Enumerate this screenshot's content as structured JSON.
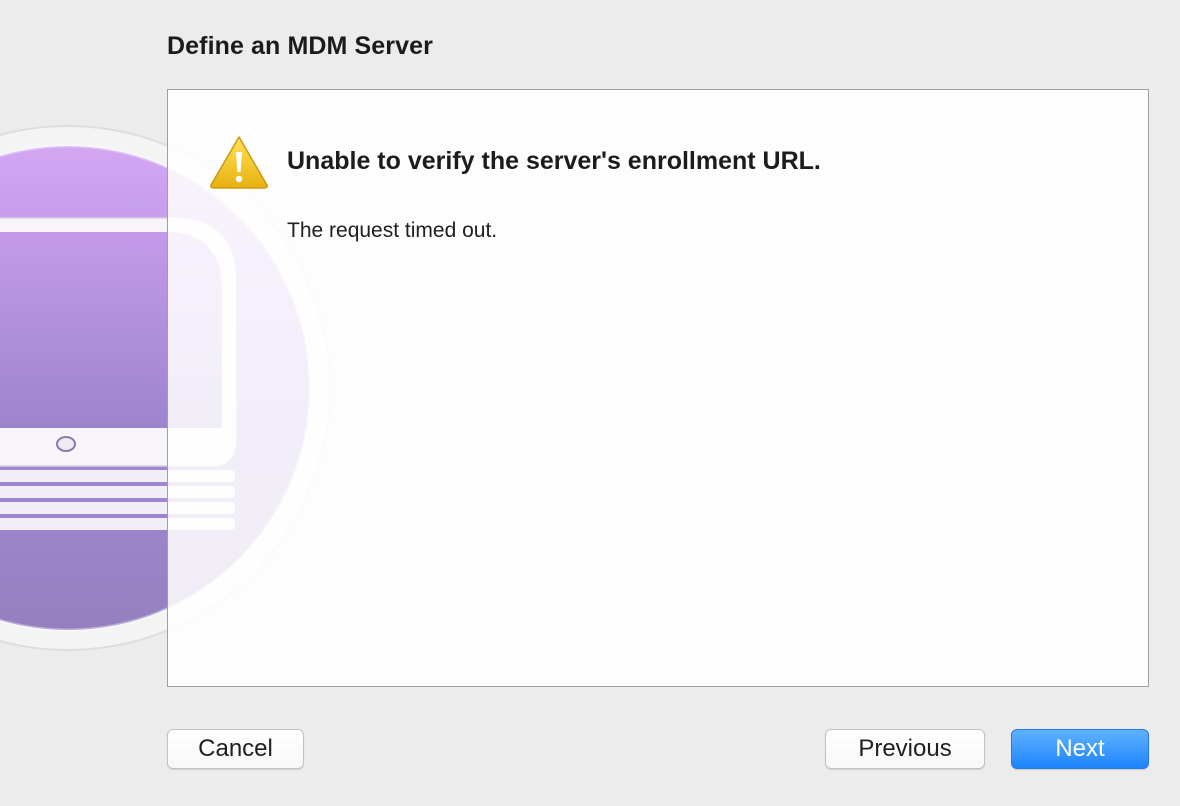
{
  "header": {
    "title": "Define an MDM Server"
  },
  "alert": {
    "icon": "warning-icon",
    "heading": "Unable to verify the server's enrollment URL.",
    "message": "The request timed out."
  },
  "footer": {
    "cancel_label": "Cancel",
    "previous_label": "Previous",
    "next_label": "Next"
  },
  "colors": {
    "accent": "#1d83fb",
    "artwork_purple": "#b48fe0",
    "warning_yellow": "#f3c21b"
  }
}
